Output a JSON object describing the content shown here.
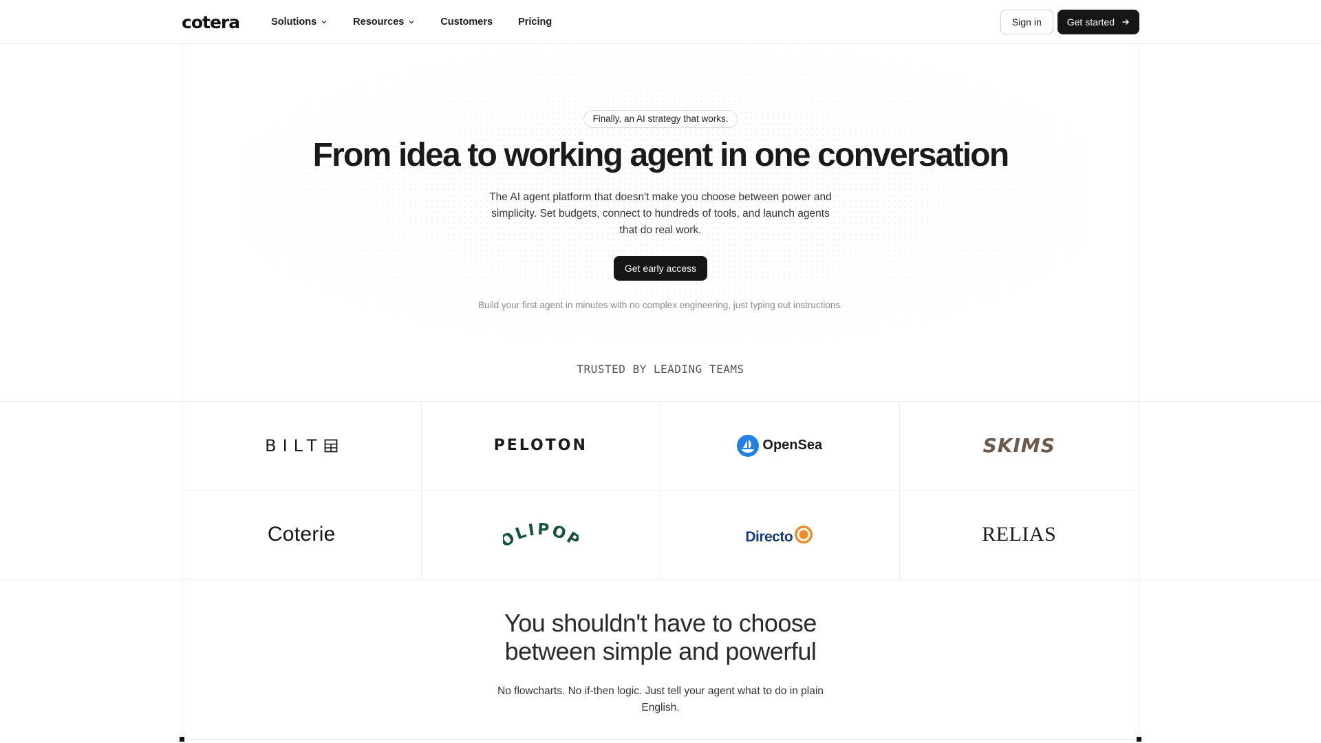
{
  "nav": {
    "logo": "cotera",
    "links": [
      {
        "label": "Solutions",
        "has_dropdown": true
      },
      {
        "label": "Resources",
        "has_dropdown": true
      },
      {
        "label": "Customers",
        "has_dropdown": false
      },
      {
        "label": "Pricing",
        "has_dropdown": false
      }
    ],
    "sign_in": "Sign in",
    "get_started": "Get started"
  },
  "hero": {
    "badge": "Finally, an AI strategy that works.",
    "title": "From idea to working agent in one conversation",
    "subtitle": "The AI agent platform that doesn't make you choose between power and simplicity. Set budgets, connect to hundreds of tools, and launch agents that do real work.",
    "cta": "Get early access",
    "note": "Build your first agent in minutes with no complex engineering, just typing out instructions."
  },
  "trusted": {
    "heading": "TRUSTED BY LEADING TEAMS",
    "logos": [
      "BILT",
      "PELOTON",
      "OpenSea",
      "SKIMS",
      "Coterie",
      "OLIPOP",
      "Directo",
      "RELIAS"
    ]
  },
  "section2": {
    "title_line1": "You shouldn't have to choose",
    "title_line2": "between simple and powerful",
    "body": "No flowcharts. No if-then logic. Just tell your agent what to do in plain English."
  },
  "colors": {
    "brand_dark": "#161616",
    "opensea_blue": "#2081e2",
    "skims_brown": "#6b5a4c",
    "olipop_green": "#14523a",
    "directo_blue": "#163a7a",
    "directo_orange": "#f08a24",
    "relias_green": "#2e7d32"
  }
}
